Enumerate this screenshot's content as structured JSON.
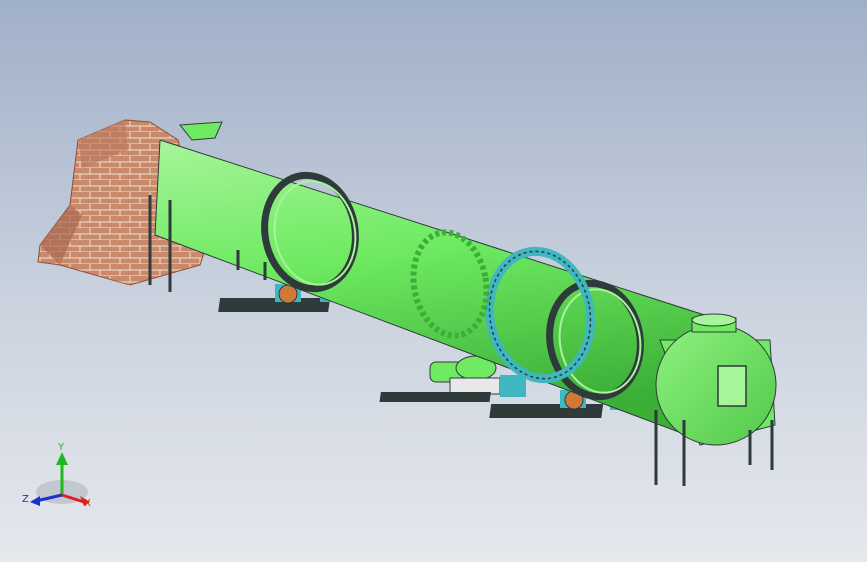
{
  "colors": {
    "shell": "#6fea62",
    "shell_dark": "#37a833",
    "shell_light": "#a6f59a",
    "brick": "#c98a6c",
    "brick_dark": "#8f4f36",
    "mortar": "#e8d2c0",
    "steel": "#2f3a3a",
    "bearing": "#3fb7c0",
    "wheel": "#d07a3a",
    "axis_x": "#e0201a",
    "axis_y": "#1fb81f",
    "axis_z": "#1e2fd0"
  },
  "triad": {
    "x_label": "X",
    "y_label": "Y",
    "z_label": "Z"
  }
}
